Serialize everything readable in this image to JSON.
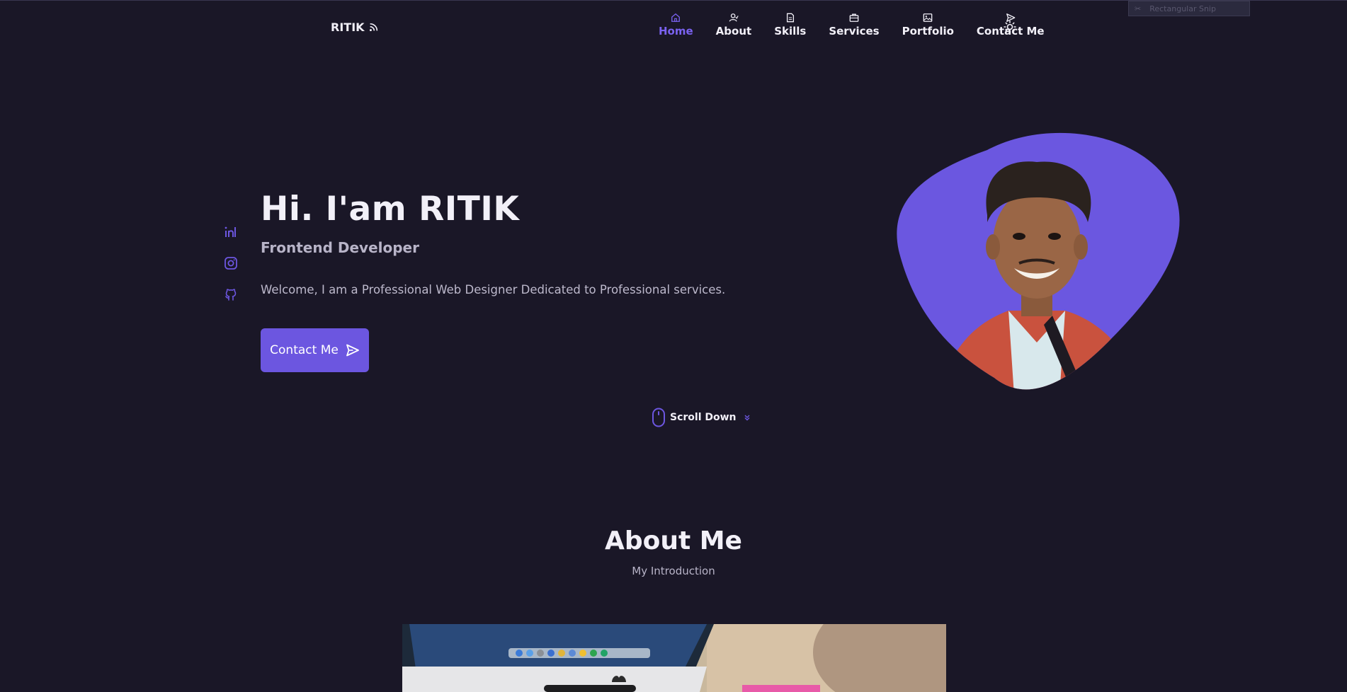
{
  "header": {
    "logo": "RITIK",
    "nav": [
      {
        "label": "Home",
        "icon": "home-icon",
        "active": true
      },
      {
        "label": "About",
        "icon": "user-icon"
      },
      {
        "label": "Skills",
        "icon": "file-icon"
      },
      {
        "label": "Services",
        "icon": "briefcase-icon"
      },
      {
        "label": "Portfolio",
        "icon": "image-icon"
      },
      {
        "label": "Contact Me",
        "icon": "send-icon"
      }
    ],
    "theme_icon": "sun-icon"
  },
  "snip_overlay": {
    "label": "Rectangular Snip"
  },
  "social": [
    {
      "name": "linkedin-icon"
    },
    {
      "name": "instagram-icon"
    },
    {
      "name": "github-icon"
    }
  ],
  "hero": {
    "title": "Hi. I'am RITIK",
    "subtitle": "Frontend Developer",
    "description": "Welcome, I am a Professional Web Designer Dedicated to Professional services.",
    "button_label": "Contact Me",
    "scroll_label": "Scroll Down"
  },
  "about": {
    "title": "About Me",
    "subtitle": "My Introduction"
  },
  "colors": {
    "background": "#1a1727",
    "accent": "#6c56e0",
    "text": "#f2f0f8",
    "muted": "#b8b4c8"
  }
}
